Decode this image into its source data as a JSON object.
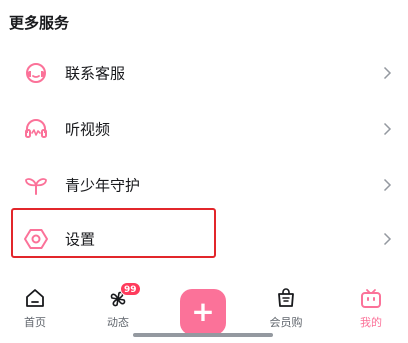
{
  "section": {
    "title": "更多服务"
  },
  "menu": [
    {
      "label": "联系客服",
      "icon": "headset-icon"
    },
    {
      "label": "听视频",
      "icon": "headphones-icon"
    },
    {
      "label": "青少年守护",
      "icon": "sprout-icon"
    },
    {
      "label": "设置",
      "icon": "settings-hexagon-icon"
    }
  ],
  "tabbar": {
    "home": {
      "label": "首页",
      "icon": "home-icon"
    },
    "dynamics": {
      "label": "动态",
      "icon": "pinwheel-icon",
      "badge": "99"
    },
    "publish": {
      "label": "+",
      "icon": "plus-icon"
    },
    "vip_shop": {
      "label": "会员购",
      "icon": "shopping-bag-icon"
    },
    "mine": {
      "label": "我的",
      "icon": "tv-icon"
    }
  },
  "colors": {
    "accent": "#fb7299",
    "highlight": "#e2262b",
    "text": "#18191c",
    "subtext": "#61666d"
  }
}
